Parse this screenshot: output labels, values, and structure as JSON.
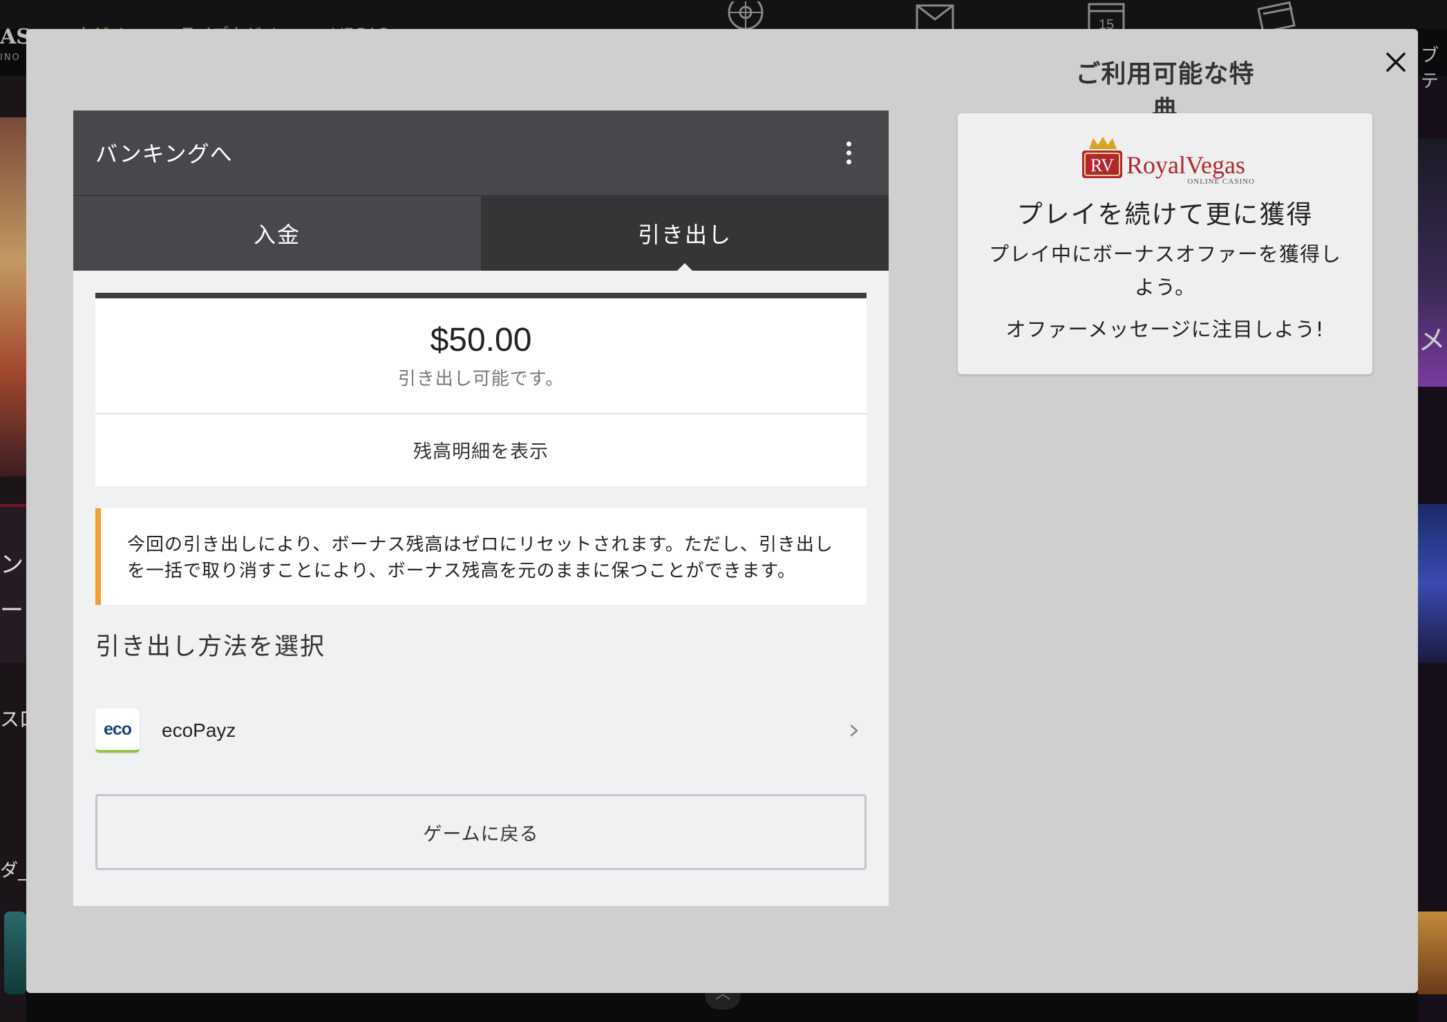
{
  "background": {
    "nav": [
      {
        "label": "カジノ",
        "active": true
      },
      {
        "label": "ライブカジノ",
        "active": false
      },
      {
        "label": "VEGAS",
        "active": false
      }
    ],
    "logo_text": "AS",
    "logo_sub": "INO",
    "calendar_day": "15",
    "left_texts": [
      "ン",
      "ー",
      "ス口",
      "ダ_"
    ],
    "right_texts": [
      "ブテ",
      "メ"
    ]
  },
  "modal": {
    "close_icon": "close-icon",
    "banking": {
      "title": "バンキングへ",
      "menu_icon": "kebab-menu-icon",
      "tabs": [
        {
          "label": "入金",
          "active": false
        },
        {
          "label": "引き出し",
          "active": true
        }
      ],
      "balance": {
        "amount": "$50.00",
        "caption": "引き出し可能です。",
        "detail_link": "残高明細を表示"
      },
      "notice": "今回の引き出しにより、ボーナス残高はゼロにリセットされます。ただし、引き出しを一括で取り消すことにより、ボーナス残高を元のままに保つことができます。",
      "method_heading": "引き出し方法を選択",
      "methods": [
        {
          "logo_text": "eco",
          "label": "ecoPayz"
        }
      ],
      "back_button": "ゲームに戻る"
    },
    "offers": {
      "title": "ご利用可能な特典",
      "brand_initials": "RV",
      "brand_name": "RoyalVegas",
      "brand_sub": "ONLINE CASINO",
      "heading": "プレイを続けて更に獲得",
      "text": "プレイ中にボーナスオファーを獲得しよう。",
      "text2": "オファーメッセージに注目しよう!"
    }
  },
  "colors": {
    "modal_bg": "#cfcfcf",
    "header_bg": "#48474b",
    "active_tab_bg": "#353437",
    "notice_accent": "#f0a030",
    "brand_red": "#b0272d"
  }
}
